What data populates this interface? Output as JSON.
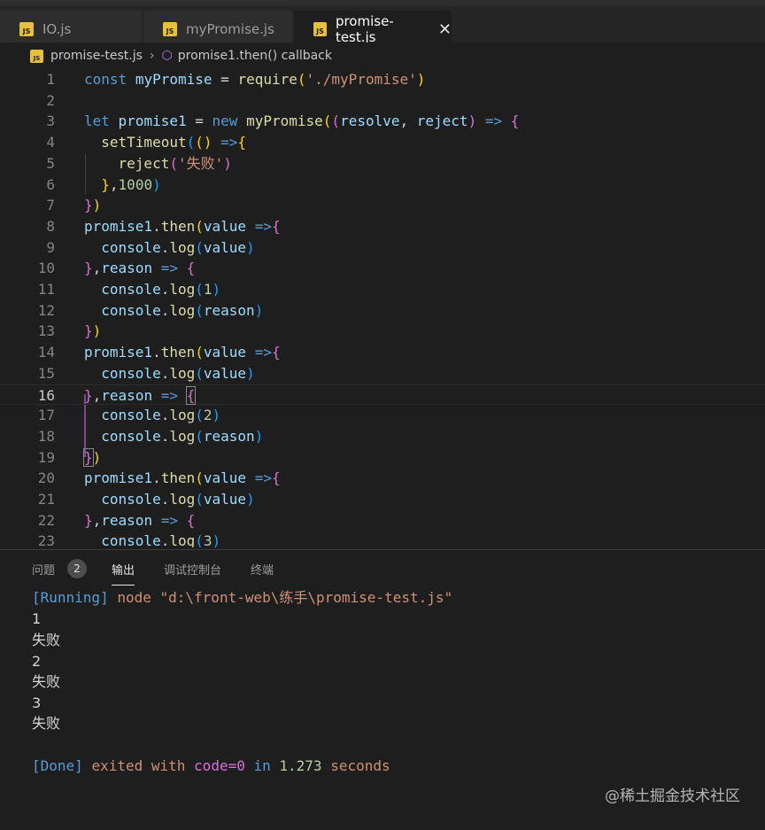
{
  "tabs": [
    {
      "label": "IO.js",
      "icon": "js-file-icon",
      "active": false
    },
    {
      "label": "myPromise.js",
      "icon": "js-file-icon",
      "active": false
    },
    {
      "label": "promise-test.js",
      "icon": "js-file-icon",
      "active": true
    }
  ],
  "js_icon_text": "JS",
  "close_glyph": "✕",
  "breadcrumb": {
    "file": "promise-test.js",
    "separator": "›",
    "symbol_glyph": "⬡",
    "symbol": "promise1.then() callback"
  },
  "code_lines": [
    {
      "n": "1"
    },
    {
      "n": "2"
    },
    {
      "n": "3"
    },
    {
      "n": "4"
    },
    {
      "n": "5"
    },
    {
      "n": "6"
    },
    {
      "n": "7"
    },
    {
      "n": "8"
    },
    {
      "n": "9"
    },
    {
      "n": "10"
    },
    {
      "n": "11"
    },
    {
      "n": "12"
    },
    {
      "n": "13"
    },
    {
      "n": "14"
    },
    {
      "n": "15"
    },
    {
      "n": "16"
    },
    {
      "n": "17"
    },
    {
      "n": "18"
    },
    {
      "n": "19"
    },
    {
      "n": "20"
    },
    {
      "n": "21"
    },
    {
      "n": "22"
    },
    {
      "n": "23"
    }
  ],
  "panel": {
    "tabs": [
      "问题",
      "输出",
      "调试控制台",
      "终端"
    ],
    "problem_count": "2",
    "active_tab": "输出",
    "output": {
      "running_tag": "[Running]",
      "running_cmd": "node \"d:\\front-web\\练手\\promise-test.js\"",
      "lines": [
        "1",
        "失败",
        "2",
        "失败",
        "3",
        "失败"
      ],
      "done_tag": "[Done]",
      "done_exited": "exited with",
      "done_code": "code=0",
      "done_in": "in",
      "done_seconds": "1.273",
      "done_unit": "seconds"
    }
  },
  "watermark": "@稀土掘金技术社区",
  "colors": {
    "keyword": "#569cd6",
    "variable": "#9cdcfe",
    "function": "#dcdcaa",
    "string": "#ce9178",
    "number": "#b5cea8"
  }
}
